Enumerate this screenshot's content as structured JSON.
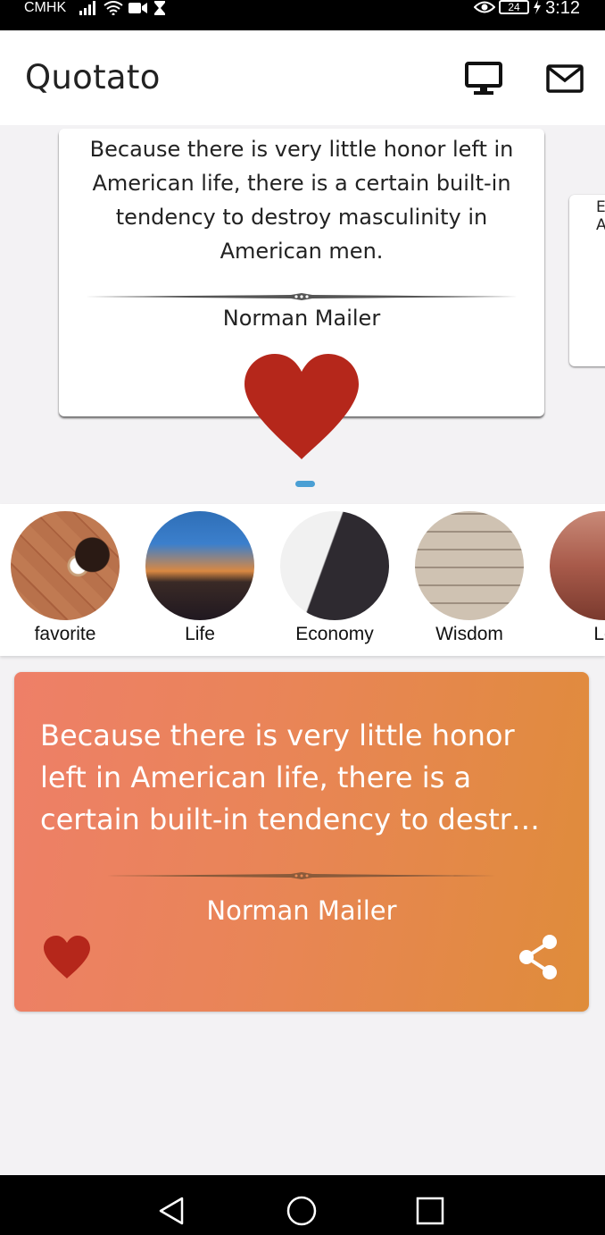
{
  "status_bar": {
    "carrier": "CMHK",
    "battery": "24",
    "time": "3:12"
  },
  "app_bar": {
    "title": "Quotato",
    "icons": [
      "monitor-icon",
      "mail-icon"
    ]
  },
  "carousel": {
    "current_quote": {
      "text": "Because there is very little honor left in American life, there is a certain built-in tendency to destroy masculinity in American men.",
      "author": "Norman Mailer",
      "favorited": true
    },
    "next_quote_preview": [
      "E",
      "A"
    ]
  },
  "categories": [
    {
      "label": "favorite",
      "image": "coffee-on-wood-floor"
    },
    {
      "label": "Life",
      "image": "city-sunset-skyline"
    },
    {
      "label": "Economy",
      "image": "businessman-with-coffee"
    },
    {
      "label": "Wisdom",
      "image": "open-books-wall"
    },
    {
      "label": "Lo",
      "image": "autumn-park"
    }
  ],
  "featured_quote": {
    "text": "Because there is very little honor left in American life, there is a certain built-in tendency to destr…",
    "author": "Norman Mailer",
    "favorited": true
  },
  "colors": {
    "heart": "#b5271b",
    "card_gradient_start": "#ee7f68",
    "card_gradient_end": "#df8c3a",
    "page_indicator": "#4a9fd4"
  }
}
